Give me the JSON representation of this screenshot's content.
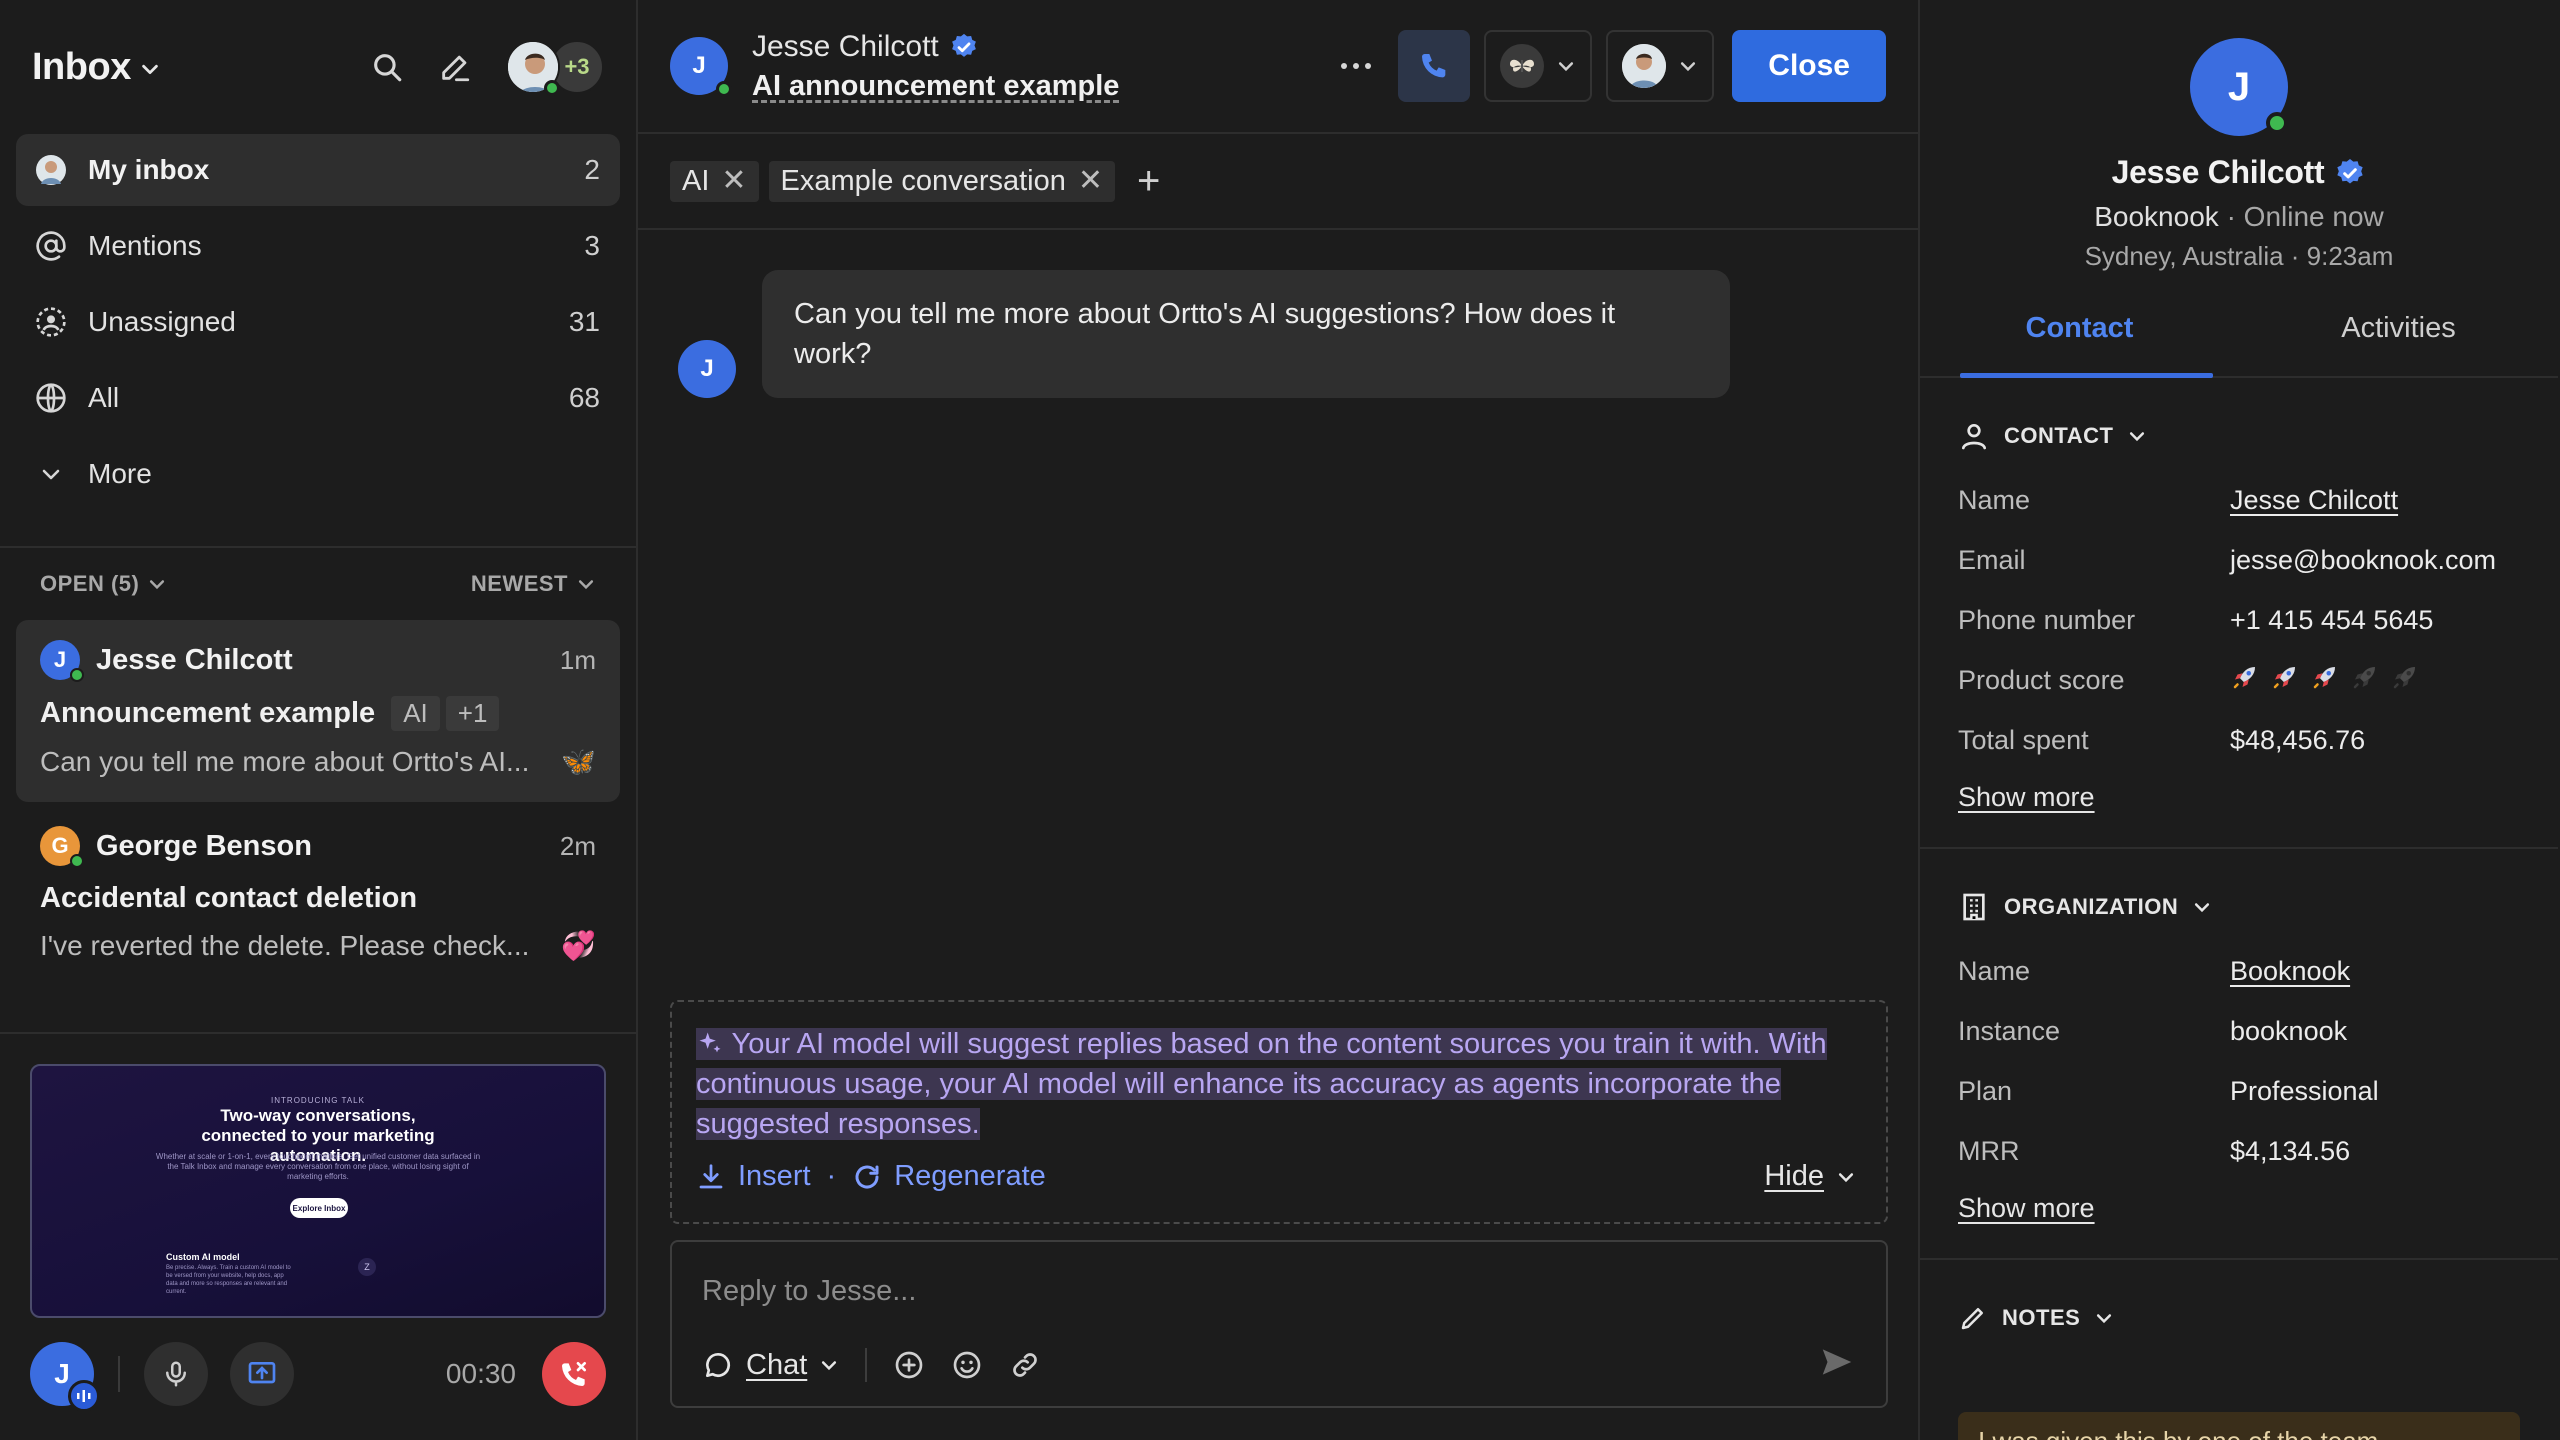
{
  "left": {
    "title": "Inbox",
    "more_avatars": "+3",
    "nav": [
      {
        "label": "My inbox",
        "count": "2"
      },
      {
        "label": "Mentions",
        "count": "3"
      },
      {
        "label": "Unassigned",
        "count": "31"
      },
      {
        "label": "All",
        "count": "68"
      },
      {
        "label": "More",
        "count": ""
      }
    ],
    "list_filter": "OPEN (5)",
    "list_sort": "NEWEST",
    "conversations": [
      {
        "initial": "J",
        "name": "Jesse Chilcott",
        "time": "1m",
        "subject": "Announcement example",
        "tags": [
          "AI",
          "+1"
        ],
        "preview": "Can you tell me more about Ortto's AI...",
        "emoji": "🦋",
        "avatar_color": "#3b6de0"
      },
      {
        "initial": "G",
        "name": "George Benson",
        "time": "2m",
        "subject": "Accidental contact deletion",
        "tags": [],
        "preview": "I've reverted the delete. Please check...",
        "emoji": "💞",
        "avatar_color": "#e8963a"
      }
    ],
    "video": {
      "kicker": "INTRODUCING TALK",
      "title": "Two-way conversations, connected to your marketing automation.",
      "body": "Whether at scale or 1-on-1, every touchpoint matters. Get unified customer data surfaced in the Talk Inbox and manage every conversation from one place, without losing sight of marketing efforts.",
      "button": "Explore Inbox",
      "sub_title": "Custom AI model",
      "sub_body": "Be precise. Always. Train a custom AI model to be versed from your website, help docs, app data and more so responses are relevant and current.",
      "logo": "Z"
    },
    "call": {
      "initial": "J",
      "timer": "00:30"
    }
  },
  "center": {
    "contact_initial": "J",
    "contact_name": "Jesse Chilcott",
    "subject": "AI announcement example",
    "close_label": "Close",
    "tags": [
      "AI",
      "Example conversation"
    ],
    "add_tag": "+",
    "message": "Can you tell me more about Ortto's AI suggestions? How does it work?",
    "ai_suggestion": "Your AI model will suggest replies based on the content sources you train it with. With continuous usage, your AI model will enhance its accuracy as agents incorporate the suggested responses.",
    "ai_insert": "Insert",
    "ai_sep": "·",
    "ai_regenerate": "Regenerate",
    "ai_hide": "Hide",
    "reply_placeholder": "Reply to Jesse...",
    "channel": "Chat"
  },
  "right": {
    "initial": "J",
    "name": "Jesse Chilcott",
    "company": "Booknook",
    "status": "Online now",
    "location": "Sydney, Australia · 9:23am",
    "tabs": [
      "Contact",
      "Activities"
    ],
    "contact_section": "CONTACT",
    "contact_fields": [
      {
        "k": "Name",
        "v": "Jesse Chilcott"
      },
      {
        "k": "Email",
        "v": "jesse@booknook.com"
      },
      {
        "k": "Phone number",
        "v": "+1 415 454 5645"
      },
      {
        "k": "Product score",
        "v": ""
      },
      {
        "k": "Total spent",
        "v": "$48,456.76"
      }
    ],
    "product_score": 3,
    "product_score_max": 5,
    "show_more": "Show more",
    "org_section": "ORGANIZATION",
    "org_fields": [
      {
        "k": "Name",
        "v": "Booknook"
      },
      {
        "k": "Instance",
        "v": "booknook"
      },
      {
        "k": "Plan",
        "v": "Professional"
      },
      {
        "k": "MRR",
        "v": "$4,134.56"
      }
    ],
    "notes_section": "NOTES",
    "note_preview": "I was given this by one of the team..."
  },
  "colors": {
    "accent": "#2f6bdf",
    "online": "#3fb950",
    "ai_text": "#b8a6f2",
    "danger": "#e5484d"
  }
}
